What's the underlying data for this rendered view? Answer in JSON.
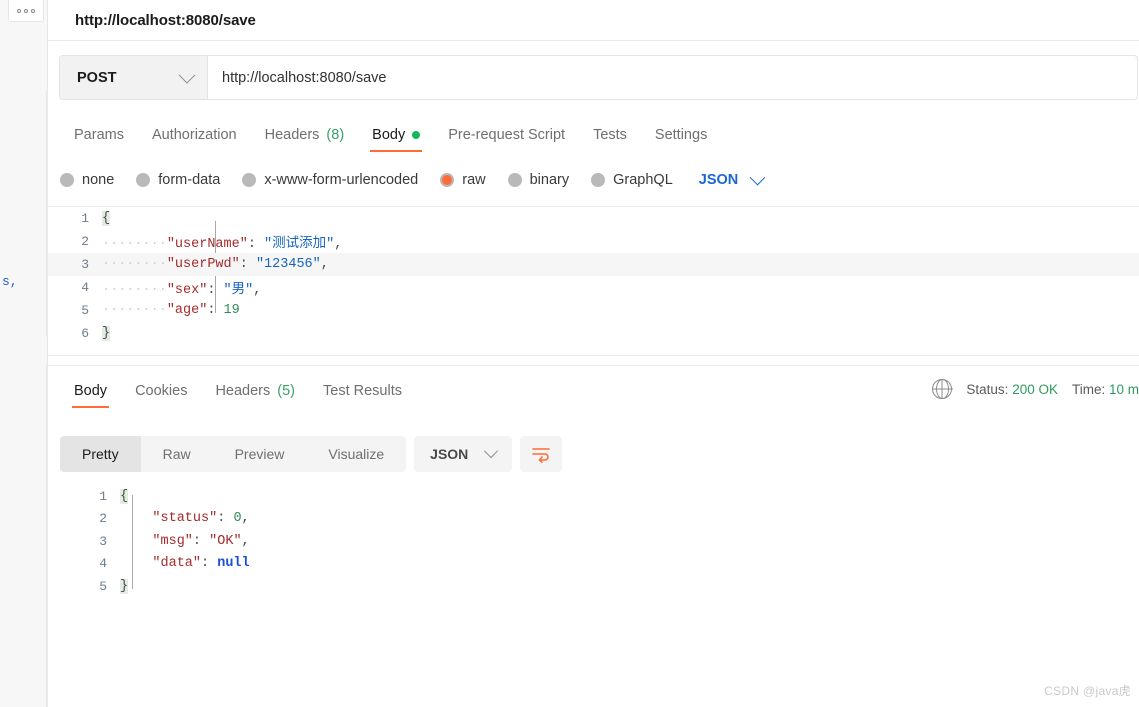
{
  "background": {
    "fragment_text": "s,",
    "kebab_icon": "more-options-icon"
  },
  "request": {
    "title": "http://localhost:8080/save",
    "method": "POST",
    "url": "http://localhost:8080/save",
    "tabs": [
      {
        "label": "Params",
        "active": false
      },
      {
        "label": "Authorization",
        "active": false
      },
      {
        "label": "Headers",
        "count": "(8)",
        "active": false
      },
      {
        "label": "Body",
        "active": true,
        "dot": true
      },
      {
        "label": "Pre-request Script",
        "active": false
      },
      {
        "label": "Tests",
        "active": false
      },
      {
        "label": "Settings",
        "active": false
      }
    ],
    "body_types": [
      {
        "label": "none",
        "selected": false
      },
      {
        "label": "form-data",
        "selected": false
      },
      {
        "label": "x-www-form-urlencoded",
        "selected": false
      },
      {
        "label": "raw",
        "selected": true
      },
      {
        "label": "binary",
        "selected": false
      },
      {
        "label": "GraphQL",
        "selected": false
      }
    ],
    "format": "JSON",
    "code": {
      "lines": [
        "1",
        "2",
        "3",
        "4",
        "5",
        "6"
      ],
      "l1": "{",
      "l2_dots": "········",
      "l2_key": "\"userName\"",
      "l2_colon": ":",
      "l2_val": "\"测试添加\"",
      "l2_comma": ",",
      "l3_key": "\"userPwd\"",
      "l3_colon": ":",
      "l3_val": "\"123456\"",
      "l3_comma": ",",
      "l4_key": "\"sex\"",
      "l4_colon": ":",
      "l4_val": "\"男\"",
      "l4_comma": ",",
      "l5_key": "\"age\"",
      "l5_colon": ":",
      "l5_val": "19",
      "l6": "}"
    }
  },
  "response": {
    "tabs": [
      {
        "label": "Body",
        "active": true
      },
      {
        "label": "Cookies",
        "active": false
      },
      {
        "label": "Headers",
        "count": "(5)",
        "active": false
      },
      {
        "label": "Test Results",
        "active": false
      }
    ],
    "status_label": "Status:",
    "status_value": "200 OK",
    "time_label": "Time:",
    "time_value": "10 m",
    "view_modes": [
      {
        "label": "Pretty",
        "active": true
      },
      {
        "label": "Raw",
        "active": false
      },
      {
        "label": "Preview",
        "active": false
      },
      {
        "label": "Visualize",
        "active": false
      }
    ],
    "format": "JSON",
    "code": {
      "lines": [
        "1",
        "2",
        "3",
        "4",
        "5"
      ],
      "l1": "{",
      "l2_key": "\"status\"",
      "l2_colon": ":",
      "l2_val": "0",
      "l2_comma": ",",
      "l3_key": "\"msg\"",
      "l3_colon": ":",
      "l3_val": "\"OK\"",
      "l3_comma": ",",
      "l4_key": "\"data\"",
      "l4_colon": ":",
      "l4_val": "null",
      "l5": "}"
    }
  },
  "watermark": "CSDN @java虎",
  "colors": {
    "accent": "#ff6c37",
    "status_ok": "#2d9a5f",
    "json_blue": "#1a66d6",
    "body_dot_green": "#0fb85a"
  }
}
